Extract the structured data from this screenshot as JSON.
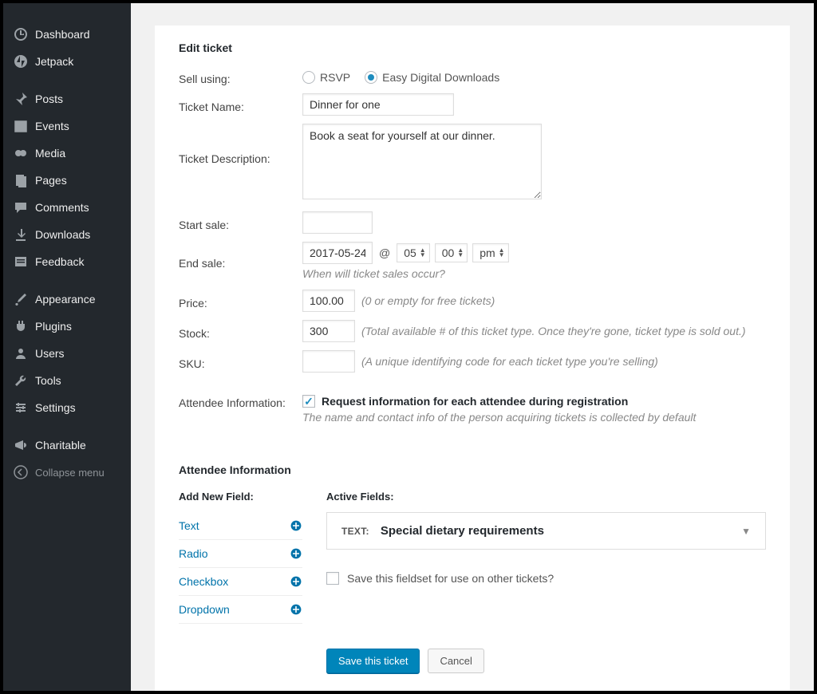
{
  "sidebar": {
    "items": [
      {
        "label": "Dashboard",
        "icon": "dashboard"
      },
      {
        "label": "Jetpack",
        "icon": "jetpack"
      }
    ],
    "items2": [
      {
        "label": "Posts",
        "icon": "pin"
      },
      {
        "label": "Events",
        "icon": "calendar"
      },
      {
        "label": "Media",
        "icon": "media"
      },
      {
        "label": "Pages",
        "icon": "pages"
      },
      {
        "label": "Comments",
        "icon": "comment"
      },
      {
        "label": "Downloads",
        "icon": "download"
      },
      {
        "label": "Feedback",
        "icon": "feedback"
      }
    ],
    "items3": [
      {
        "label": "Appearance",
        "icon": "brush"
      },
      {
        "label": "Plugins",
        "icon": "plug"
      },
      {
        "label": "Users",
        "icon": "user"
      },
      {
        "label": "Tools",
        "icon": "wrench"
      },
      {
        "label": "Settings",
        "icon": "settings"
      }
    ],
    "items4": [
      {
        "label": "Charitable",
        "icon": "megaphone"
      }
    ],
    "collapse": "Collapse menu"
  },
  "edit": {
    "title": "Edit ticket",
    "sell_using_label": "Sell using:",
    "sell_rsvp": "RSVP",
    "sell_edd": "Easy Digital Downloads",
    "ticket_name_label": "Ticket Name:",
    "ticket_name": "Dinner for one",
    "ticket_desc_label": "Ticket Description:",
    "ticket_desc": "Book a seat for yourself at our dinner.",
    "start_sale_label": "Start sale:",
    "start_sale": "",
    "end_sale_label": "End sale:",
    "end_date": "2017-05-24",
    "end_hour": "05",
    "end_min": "00",
    "end_ampm": "pm",
    "sale_hint": "When will ticket sales occur?",
    "price_label": "Price:",
    "price": "100.00",
    "price_hint": "(0 or empty for free tickets)",
    "stock_label": "Stock:",
    "stock": "300",
    "stock_hint": "(Total available # of this ticket type. Once they're gone, ticket type is sold out.)",
    "sku_label": "SKU:",
    "sku": "",
    "sku_hint": "(A unique identifying code for each ticket type you're selling)",
    "attendee_info_label": "Attendee Information:",
    "attendee_checkbox_label": "Request information for each attendee during registration",
    "attendee_checkbox_hint": "The name and contact info of the person acquiring tickets is collected by default"
  },
  "attendee": {
    "section_title": "Attendee Information",
    "add_new_label": "Add New Field:",
    "active_fields_label": "Active Fields:",
    "field_types": [
      "Text",
      "Radio",
      "Checkbox",
      "Dropdown"
    ],
    "active_field_type": "TEXT:",
    "active_field_name": "Special dietary requirements",
    "save_fieldset_label": "Save this fieldset for use on other tickets?"
  },
  "buttons": {
    "save": "Save this ticket",
    "cancel": "Cancel"
  }
}
